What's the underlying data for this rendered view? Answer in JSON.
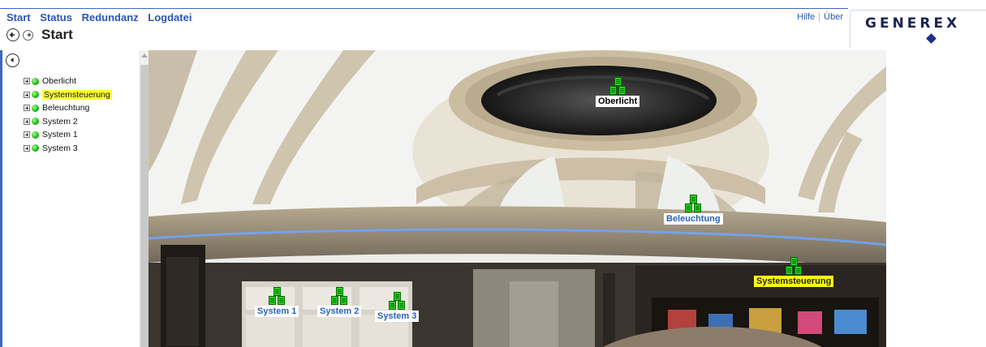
{
  "menu": {
    "items": [
      "Start",
      "Status",
      "Redundanz",
      "Logdatei"
    ],
    "help": "Hilfe",
    "about": "Über",
    "separator": "|"
  },
  "logo": {
    "text": "GENEREX"
  },
  "page": {
    "title": "Start"
  },
  "tree": {
    "items": [
      {
        "label": "Oberlicht",
        "status": "ok",
        "highlighted": false
      },
      {
        "label": "Systemsteuerung",
        "status": "ok",
        "highlighted": true
      },
      {
        "label": "Beleuchtung",
        "status": "ok",
        "highlighted": false
      },
      {
        "label": "System 2",
        "status": "ok",
        "highlighted": false
      },
      {
        "label": "System 1",
        "status": "ok",
        "highlighted": false
      },
      {
        "label": "System 3",
        "status": "ok",
        "highlighted": false
      }
    ]
  },
  "markers": [
    {
      "label": "Oberlicht",
      "style": "white"
    },
    {
      "label": "Beleuchtung",
      "style": "blue"
    },
    {
      "label": "Systemsteuerung",
      "style": "yellow"
    },
    {
      "label": "System 1",
      "style": "blue"
    },
    {
      "label": "System 2",
      "style": "blue"
    },
    {
      "label": "System 3",
      "style": "blue"
    }
  ],
  "colors": {
    "link": "#2a55b8",
    "status_ok": "#22b41a",
    "highlight": "#ffff33",
    "label_blue": "#2b62b9"
  },
  "icons": [
    "back-icon",
    "forward-icon",
    "collapse-icon",
    "expand-icon",
    "status-dot-icon",
    "server-group-icon"
  ]
}
